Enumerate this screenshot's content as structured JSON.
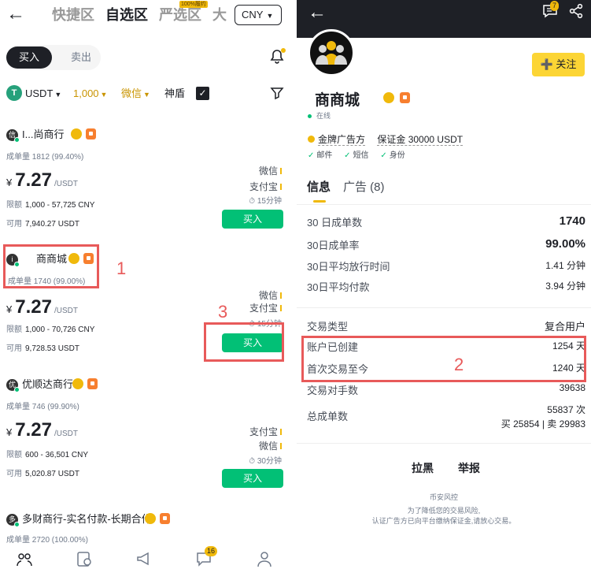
{
  "left": {
    "tabs": [
      "快捷区",
      "自选区",
      "严选区",
      "大"
    ],
    "tab_tag": "100%履约",
    "currency": "CNY",
    "buy_tab": "买入",
    "sell_tab": "卖出",
    "filters": {
      "coin": "USDT",
      "amount": "1,000",
      "payment": "微信",
      "shield": "神盾"
    },
    "ads": [
      {
        "avatar": "信",
        "name": "I...尚商行",
        "stats": "成单量 1812 (99.40%)",
        "currency": "¥",
        "price": "7.27",
        "unit": "/USDT",
        "limit_label": "限额",
        "limit": "1,000 - 57,725 CNY",
        "avail_label": "可用",
        "avail": "7,940.27 USDT",
        "payments": [
          "微信",
          "支付宝"
        ],
        "time_limit": "15分钟",
        "buy": "买入"
      },
      {
        "avatar": "i",
        "name": "商商城",
        "stats": "成单量 1740 (99.00%)",
        "currency": "¥",
        "price": "7.27",
        "unit": "/USDT",
        "limit_label": "限额",
        "limit": "1,000 - 70,726 CNY",
        "avail_label": "可用",
        "avail": "9,728.53 USDT",
        "payments": [
          "微信",
          "支付宝"
        ],
        "time_limit": "15分钟",
        "buy": "买入"
      },
      {
        "avatar": "优",
        "name": "优顺达商行",
        "stats": "成单量 746 (99.90%)",
        "currency": "¥",
        "price": "7.27",
        "unit": "/USDT",
        "limit_label": "限额",
        "limit": "600 - 36,501 CNY",
        "avail_label": "可用",
        "avail": "5,020.87 USDT",
        "payments": [
          "支付宝",
          "微信"
        ],
        "time_limit": "30分钟",
        "buy": "买入"
      },
      {
        "avatar": "多",
        "name": "多财商行-实名付款-长期合作",
        "stats": "成单量 2720 (100.00%)"
      }
    ],
    "annotations": [
      "1",
      "3"
    ],
    "nav_badge": "16"
  },
  "right": {
    "chat_badge": "7",
    "follow": "关注",
    "name": "商商城",
    "online": "在线",
    "gold_label": "金牌广告方",
    "deposit": "保证金 30000 USDT",
    "verified": [
      "邮件",
      "短信",
      "身份"
    ],
    "tabs": {
      "info": "信息",
      "ads": "广告 (8)"
    },
    "stats": [
      {
        "label": "30 日成单数",
        "value": "1740"
      },
      {
        "label": "30日成单率",
        "value": "99.00%"
      },
      {
        "label": "30日平均放行时间",
        "value": "1.41 分钟"
      },
      {
        "label": "30日平均付款",
        "value": "3.94 分钟"
      }
    ],
    "details": [
      {
        "label": "交易类型",
        "value": "复合用户"
      },
      {
        "label": "账户已创建",
        "value": "1254 天"
      },
      {
        "label": "首次交易至今",
        "value": "1240 天"
      },
      {
        "label": "交易对手数",
        "value": "39638"
      },
      {
        "label": "总成单数",
        "value": "55837 次"
      }
    ],
    "total_split": "买 25854 | 卖 29983",
    "actions": {
      "block": "拉黑",
      "report": "举报"
    },
    "footer": [
      "币安风控",
      "为了降低您的交易风险,",
      "认证广告方已向平台缴纳保证金,请放心交易。"
    ],
    "annotation": "2"
  }
}
